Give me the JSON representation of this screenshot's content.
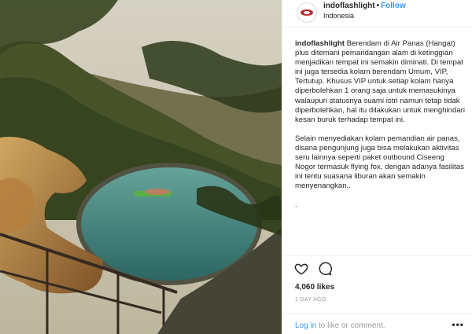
{
  "post": {
    "username": "indoflashlight",
    "follow_label": "Follow",
    "separator": "•",
    "location": "Indonesia",
    "caption_user": "indoflashlight",
    "caption_p1": "Berendam di Air Panas (Hangat) plus ditemani pemandangan alam di ketinggian menjadikan tempat ini semakin diminati. Di tempat ini juga tersedia kolam berendam Umum, VIP, Tertutup. Khusus VIP untuk setiap kolam hanya diperbolehkan 1 orang saja untuk memasukinya walaupun statusnya suami istri namun tetap tidak diperbolehkan, hal itu dilakukan untuk menghindari kesan buruk terhadap tempat ini.",
    "caption_p2": "Selain menyediakan kolam pemandian air panas, disana pengunjung juga bisa melakukan aktivitas seru lainnya seperti paket outbound Ciseeng Nogor termasuk flying fox, dengan adanya fasilitas ini tentu suasana liburan akan semakin menyenangkan..",
    "caption_p3": ".",
    "likes": "4,060 likes",
    "time": "1 DAY AGO",
    "login_link": "Log in",
    "login_rest": " to like or comment.",
    "more": "•••"
  },
  "icons": {
    "like": "heart-icon",
    "comment": "comment-icon",
    "more": "more-options-icon"
  },
  "colors": {
    "link": "#3897f0",
    "text": "#262626",
    "muted": "#999999",
    "border": "#efefef"
  }
}
